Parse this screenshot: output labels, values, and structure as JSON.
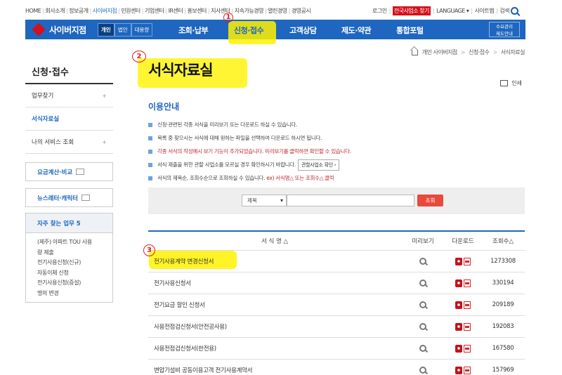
{
  "utility_left": [
    "HOME",
    "회사소개",
    "정보공개",
    "사이버지점",
    "민원센터",
    "기업센터",
    "IR센터",
    "홍보센터",
    "지사센터",
    "지속가능경영",
    "열린경영",
    "경영공시"
  ],
  "utility_left_active": "사이버지점",
  "utility_right": {
    "login": "로그인",
    "find_office": "전국사업소 찾기",
    "language": "LANGUAGE ▾",
    "sitemap": "사이트맵",
    "search": "검색"
  },
  "nav": {
    "logo": "사이버지점",
    "segments": [
      "개인",
      "법인",
      "대용량"
    ],
    "items": [
      "조회·납부",
      "신청·접수",
      "고객상담",
      "제도·약관",
      "통합포털"
    ],
    "active": "신청·접수",
    "right_box": [
      "수요관리",
      "제도안내"
    ]
  },
  "annotations": [
    "1",
    "2",
    "3"
  ],
  "breadcrumb": [
    "개인 사이버지점",
    "신청·접수",
    "서식자료실"
  ],
  "sidebar": {
    "title": "신청·접수",
    "items": [
      {
        "label": "업무찾기",
        "plus": "+"
      },
      {
        "label": "서식자료실",
        "plus": ""
      },
      {
        "label": "나의 서비스 조회",
        "plus": "+"
      }
    ],
    "box1": "요금계산·비교",
    "box2": "뉴스레터·캐릭터",
    "faq_title": "자주 찾는 업무 5",
    "faq_items": [
      "(제주) 아파트 TOU 사용",
      "량 제출",
      "전기사용신청(신규)",
      "자동이체 신청",
      "전기사용신청(증설)",
      "명의 변경"
    ]
  },
  "main": {
    "title": "서식자료실",
    "print": "인쇄",
    "guide_title": "이용안내",
    "guide_lines": [
      "신청·관련된 각종 서식을 미리보기 또는 다운로드 하실 수 있습니다.",
      "목록 중 찾으시는 서식에 대해 원하는 파일을 선택하여 다운로드 하시면 됩니다.",
      "각종 서식의 작성예시 보기 기능이 추가되었습니다. 미리보기를 클릭하면 확인할 수 있습니다.",
      "서식 제출을 위한 관할 사업소를 모르실 경우 확인하시기 바랍니다.",
      "서식의 제목순, 조회수순으로 조회하실 수 있습니다."
    ],
    "guide_button": "관할사업소 확인 ›",
    "guide_red_tail": "ex) 서식명△ 또는 조회수△ 클릭",
    "search_select": "제목",
    "search_value": "",
    "search_button": "조회"
  },
  "table": {
    "headers": [
      "서 식 명 △",
      "미리보기",
      "다운로드",
      "조회수△"
    ],
    "rows": [
      {
        "name": "전기사용계약 변경신청서",
        "count": "1273308"
      },
      {
        "name": "전기사용신청서",
        "count": "330194"
      },
      {
        "name": "전기요금 할인 신청서",
        "count": "209189"
      },
      {
        "name": "사용전점검신청서(안전공사용)",
        "count": "192083"
      },
      {
        "name": "사용전점검신청서(한전용)",
        "count": "167580"
      },
      {
        "name": "변압기설비 공동이용고객 전기사용계약서",
        "count": "157969"
      }
    ]
  }
}
